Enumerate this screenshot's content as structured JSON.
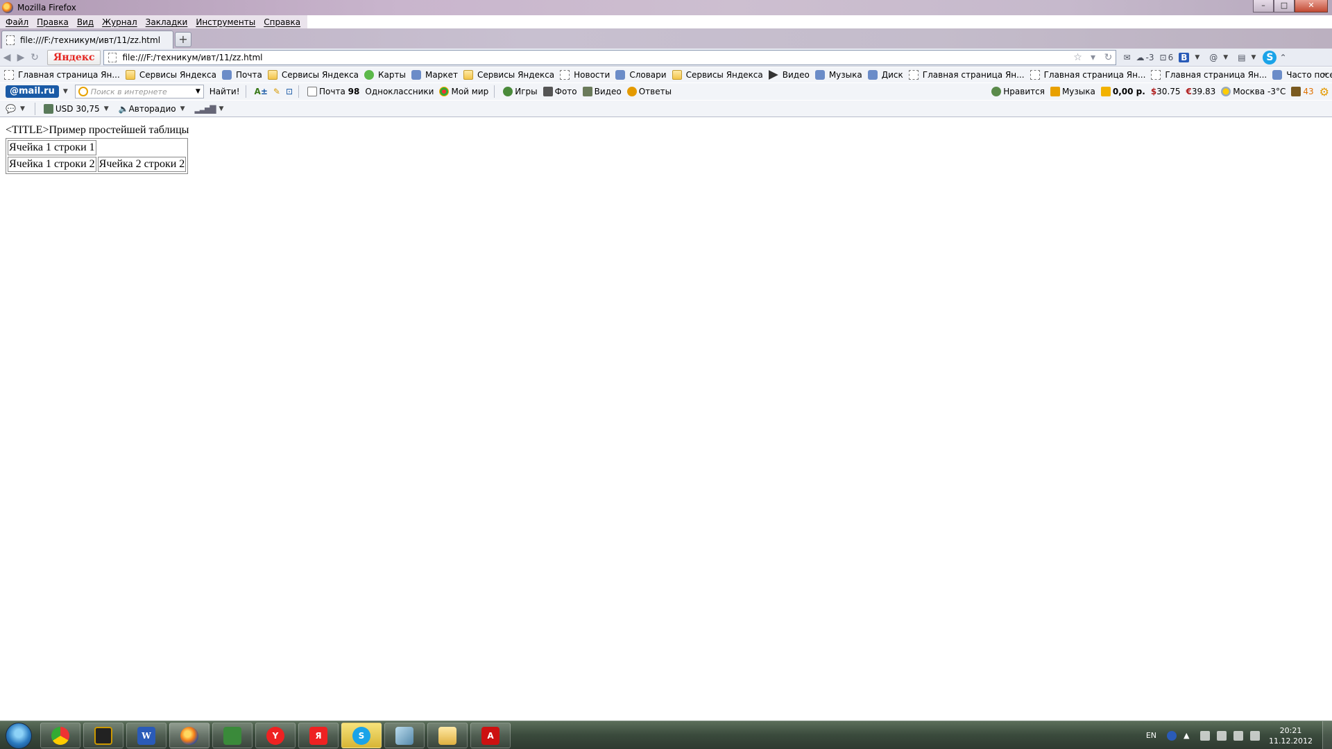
{
  "window": {
    "title": "Mozilla Firefox",
    "controls": [
      "–",
      "□",
      "✕"
    ]
  },
  "menu": [
    "Файл",
    "Правка",
    "Вид",
    "Журнал",
    "Закладки",
    "Инструменты",
    "Справка"
  ],
  "tab": {
    "label": "file:///F:/техникум/ивт/11/zz.html",
    "new_tab": "+"
  },
  "navbar": {
    "yandex_button": "Яндекс",
    "url": "file:///F:/техникум/ивт/11/zz.html",
    "weather_temp": "-3",
    "counter_6": "6",
    "b_label": "B",
    "skype_label": "S"
  },
  "bookmarks": [
    {
      "label": "Главная страница Ян...",
      "icon": "page-icon"
    },
    {
      "label": "Сервисы Яндекса",
      "icon": "folder-icon"
    },
    {
      "label": "Почта",
      "icon": "mail-icon"
    },
    {
      "label": "Сервисы Яндекса",
      "icon": "folder-icon"
    },
    {
      "label": "Карты",
      "icon": "maps-icon"
    },
    {
      "label": "Маркет",
      "icon": "market-icon"
    },
    {
      "label": "Сервисы Яндекса",
      "icon": "folder-icon"
    },
    {
      "label": "Новости",
      "icon": "news-icon"
    },
    {
      "label": "Словари",
      "icon": "dictionary-icon"
    },
    {
      "label": "Сервисы Яндекса",
      "icon": "folder-icon"
    },
    {
      "label": "Видео",
      "icon": "video-icon"
    },
    {
      "label": "Музыка",
      "icon": "music-icon"
    },
    {
      "label": "Диск",
      "icon": "disk-icon"
    },
    {
      "label": "Главная страница Ян...",
      "icon": "page-icon"
    },
    {
      "label": "Главная страница Ян...",
      "icon": "page-icon"
    },
    {
      "label": "Главная страница Ян...",
      "icon": "page-icon"
    },
    {
      "label": "Часто посещаемые",
      "icon": "gear-icon"
    }
  ],
  "mailru": {
    "logo": "@mail.ru",
    "search_placeholder": "Поиск в интернете",
    "find_button": "Найти!",
    "mail_label": "Почта",
    "mail_count": "98",
    "items": [
      "Одноклассники",
      "Мой мир",
      "Игры",
      "Фото",
      "Видео",
      "Ответы"
    ],
    "right": {
      "like": "Нравится",
      "music": "Музыка",
      "balance": "0,00 р.",
      "usd": "30.75",
      "eur": "39.83",
      "weather": "Москва -3°С",
      "count": "43"
    }
  },
  "statusbar": {
    "usd": "USD 30,75",
    "radio": "Авторадио"
  },
  "page": {
    "title_text": "<TITLE>Пример простейшей таблицы",
    "table": [
      [
        "Ячейка 1 строки 1"
      ],
      [
        "Ячейка 1 строки 2",
        "Ячейка 2 строки 2"
      ]
    ]
  },
  "taskbar": {
    "apps": [
      "chrome",
      "terminal",
      "word",
      "firefox",
      "excel",
      "yandex-browser",
      "yandex",
      "skype",
      "notepad",
      "explorer",
      "acrobat"
    ],
    "lang": "EN",
    "time": "20:21",
    "date": "11.12.2012"
  }
}
